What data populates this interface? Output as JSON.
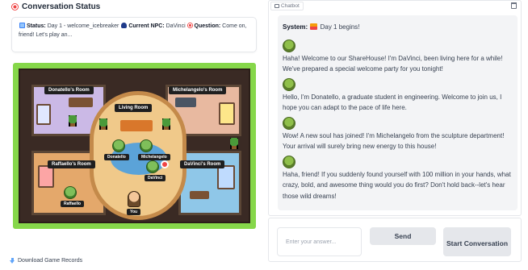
{
  "status": {
    "title": "Conversation Status",
    "status_label": "Status:",
    "status_value": "Day 1 - welcome_icebreaker",
    "npc_label": "Current NPC:",
    "npc_value": "DaVinci",
    "question_label": "Question:",
    "question_value": "Come on, friend! Let's play an..."
  },
  "map": {
    "rooms": {
      "donatello": "Donatello's Room",
      "michelangelo": "Michelangelo's Room",
      "living": "Living Room",
      "raffaello": "Raffaello's Room",
      "davinci": "DaVinci's Room"
    },
    "characters": {
      "donatello": "Donatello",
      "michelangelo": "Michelangelo",
      "davinci": "DaVinci",
      "raffaello": "Raffaello",
      "you": "You"
    }
  },
  "download_label": "Download Game Records",
  "chatbot": {
    "label": "Chatbot",
    "system_prefix": "System:",
    "system_text": "Day 1 begins!",
    "messages": [
      "Haha! Welcome to our ShareHouse! I'm DaVinci, been living here for a while! We've prepared a special welcome party for you tonight!",
      "Hello, I'm Donatello, a graduate student in engineering. Welcome to join us, I hope you can adapt to the pace of life here.",
      "Wow! A new soul has joined! I'm Michelangelo from the sculpture department! Your arrival will surely bring new energy to this house!",
      "Haha, friend! If you suddenly found yourself with 100 million in your hands, what crazy, bold, and awesome thing would you do first? Don't hold back--let's hear those wild dreams!"
    ]
  },
  "input": {
    "placeholder": "Enter your answer...",
    "send_label": "Send",
    "start_label": "Start Conversation"
  },
  "icons": [
    "dart-icon",
    "note-icon",
    "user-icon",
    "download-icon",
    "chat-bubble-icon",
    "trash-icon",
    "calendar-icon"
  ]
}
